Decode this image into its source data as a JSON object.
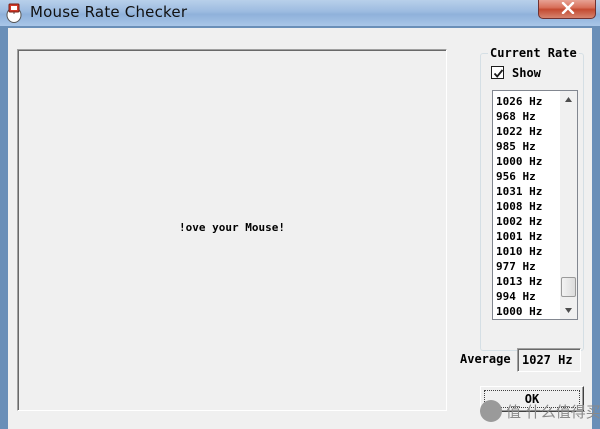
{
  "window": {
    "title": "Mouse Rate Checker",
    "app_icon": "mouse-checker-icon",
    "close_icon": "close-icon"
  },
  "canvas": {
    "message": "!ove your Mouse!"
  },
  "current_rate": {
    "group_label": "Current Rate",
    "show_label": "Show",
    "show_checked": true,
    "rates": [
      "1026 Hz",
      "968 Hz",
      "1022 Hz",
      "985 Hz",
      "1000 Hz",
      "956 Hz",
      "1031 Hz",
      "1008 Hz",
      "1002 Hz",
      "1001 Hz",
      "1010 Hz",
      "977 Hz",
      "1013 Hz",
      "994 Hz",
      "1000 Hz"
    ]
  },
  "average": {
    "label": "Average",
    "value": "1027 Hz"
  },
  "ok_button": {
    "label": "OK"
  },
  "watermark": {
    "text": "值 什么值得买"
  },
  "colors": {
    "titlebar": "#9cbbe0",
    "close_button": "#c44a31",
    "dialog_background": "#f0f0f0"
  }
}
